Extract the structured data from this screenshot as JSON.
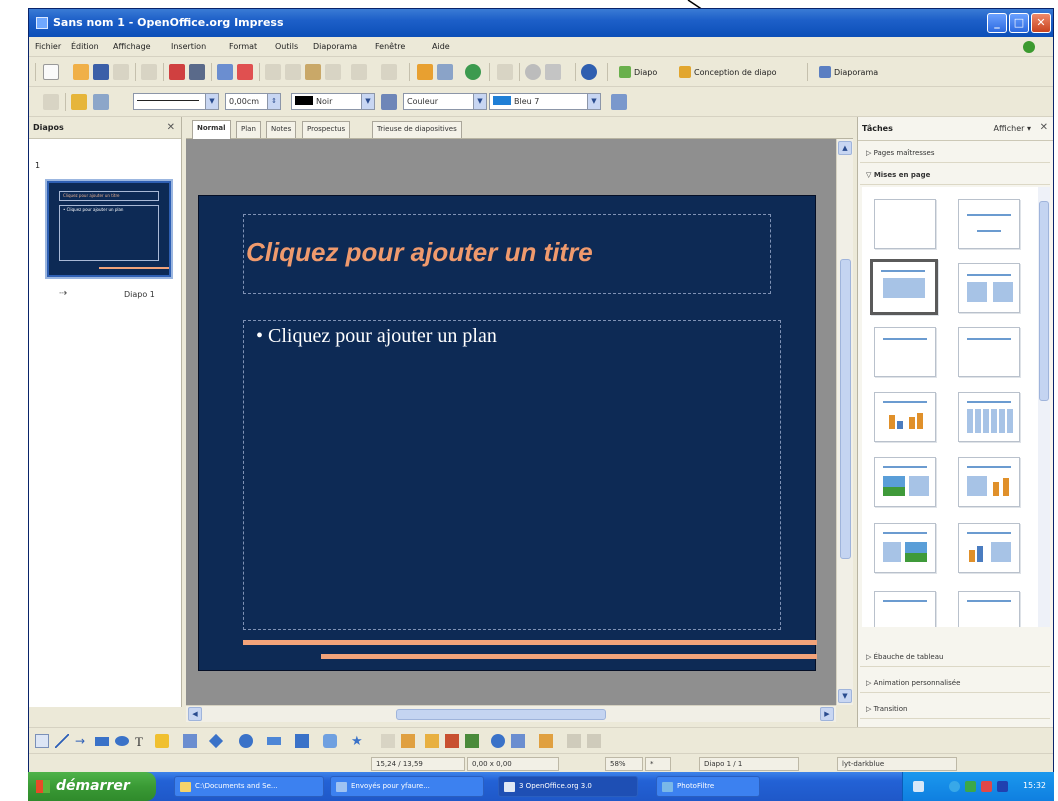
{
  "window": {
    "title": "Sans nom 1 - OpenOffice.org Impress",
    "controls": {
      "minimize": "_",
      "maximize": "□",
      "close": "✕"
    }
  },
  "menu": [
    "Fichier",
    "Édition",
    "Affichage",
    "Insertion",
    "Format",
    "Outils",
    "Diaporama",
    "Fenêtre",
    "Aide"
  ],
  "toolbar_main": {
    "slide_btn": "Diapo",
    "design_btn": "Conception de diapo",
    "show_btn": "Diaporama"
  },
  "toolbar_format": {
    "line_width": "0,00cm",
    "line_color": "Noir",
    "fill_type": "Couleur",
    "fill_color": "Bleu 7"
  },
  "left_pane": {
    "title": "Diapos",
    "close": "✕",
    "slide_number": "1",
    "slide_caption": "Diapo 1",
    "thumb_title": "Cliquez pour ajouter un titre",
    "thumb_body": "• Cliquez pour ajouter un plan"
  },
  "tabs": [
    "Normal",
    "Plan",
    "Notes",
    "Prospectus",
    "Trieuse de diapositives"
  ],
  "slide": {
    "title_placeholder": "Cliquez pour ajouter un titre",
    "body_placeholder": "• Cliquez pour ajouter un plan"
  },
  "right_pane": {
    "title": "Tâches",
    "view_menu": "Afficher ▾",
    "close": "✕",
    "sections": {
      "master_pages": "▷ Pages maîtresses",
      "layouts": "▽ Mises en page",
      "table_design": "▷ Ébauche de tableau",
      "custom_animation": "▷ Animation personnalisée",
      "transition": "▷ Transition"
    }
  },
  "statusbar": {
    "position": "15,24 / 13,59",
    "size": "0,00 x 0,00",
    "zoom": "58%",
    "modified": "*",
    "slide": "Diapo 1 / 1",
    "master": "lyt-darkblue"
  },
  "taskbar": {
    "start": "démarrer",
    "tasks": [
      "C:\\Documents and Se...",
      "Envoyés pour yfaure...",
      "3 OpenOffice.org 3.0",
      "PhotoFiltre"
    ],
    "clock": "15:32"
  },
  "colors": {
    "titlebar": "#1d5fc8",
    "slide_background": "#0d2a55",
    "title_text": "#ef9a6d",
    "accent_lines": "#f2a37a",
    "taskbar": "#2362d6",
    "start_button": "#3a9a35"
  }
}
